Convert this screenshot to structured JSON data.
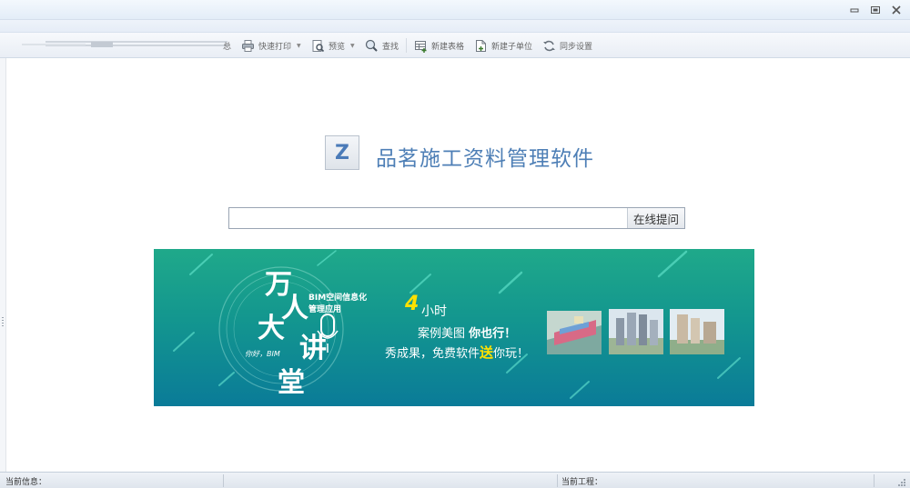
{
  "window": {
    "controls": {
      "minimize": "▭",
      "restore": "⧉",
      "close": "✕"
    }
  },
  "toolbar": {
    "partial_label": "总",
    "items": [
      {
        "label": "快速打印",
        "icon": "printer-icon"
      },
      {
        "label": "预览",
        "icon": "preview-icon"
      },
      {
        "label": "查找",
        "icon": "search-icon"
      },
      {
        "label": "新建表格",
        "icon": "new-table-icon"
      },
      {
        "label": "新建子单位",
        "icon": "new-subunit-icon"
      },
      {
        "label": "同步设置",
        "icon": "sync-icon"
      }
    ]
  },
  "main": {
    "logo_letter": "Z",
    "app_title": "品茗施工资料管理软件",
    "search": {
      "value": "",
      "button": "在线提问"
    }
  },
  "banner": {
    "title_chars": [
      "万",
      "人",
      "大",
      "讲",
      "堂"
    ],
    "subtitle_line1": "BIM空间信息化",
    "subtitle_line2": "管理应用",
    "hello": "你好，BIM",
    "hours_num": "4",
    "hours_text": "小时",
    "line1_a": "案例美图 ",
    "line1_b": "你也行！",
    "line2_a": "秀成果，免费软件",
    "line2_b": "送",
    "line2_c": "你玩！",
    "colors": {
      "top": "#1fa98a",
      "bottom": "#0a7b98",
      "highlight": "#ffe100"
    }
  },
  "status": {
    "info_label": "当前信息：",
    "project_label": "当前工程："
  }
}
